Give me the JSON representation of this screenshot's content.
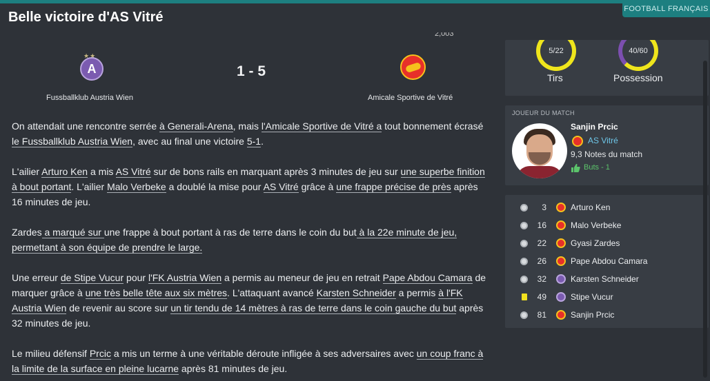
{
  "header": {
    "title": "Belle victoire d'AS Vitré",
    "tag": "FOOTBALL FRANÇAIS"
  },
  "match": {
    "home_team": "Fussballklub Austria Wien",
    "away_team": "Amicale Sportive de Vitré",
    "score": "1 - 5",
    "cut_number": "2,003"
  },
  "stats": {
    "shots": {
      "label": "Tirs",
      "value": "5/22"
    },
    "possession": {
      "label": "Possession",
      "value": "40/60"
    }
  },
  "man_of_match": {
    "heading": "JOUEUR DU MATCH",
    "name": "Sanjin Prcic",
    "club": "AS Vitré",
    "rating": "9,3 Notes du match",
    "goals": "Buts - 1"
  },
  "events": [
    {
      "type": "goal",
      "minute": "3",
      "club": "vitre",
      "player": "Arturo Ken"
    },
    {
      "type": "goal",
      "minute": "16",
      "club": "vitre",
      "player": "Malo Verbeke"
    },
    {
      "type": "goal",
      "minute": "22",
      "club": "vitre",
      "player": "Gyasi Zardes"
    },
    {
      "type": "goal",
      "minute": "26",
      "club": "vitre",
      "player": "Pape Abdou Camara"
    },
    {
      "type": "goal",
      "minute": "32",
      "club": "austria",
      "player": "Karsten Schneider"
    },
    {
      "type": "yellow-card",
      "minute": "49",
      "club": "austria",
      "player": "Stipe Vucur"
    },
    {
      "type": "goal",
      "minute": "81",
      "club": "vitre",
      "player": "Sanjin Prcic"
    }
  ],
  "article": {
    "p1": [
      "On attendait une rencontre serrée ",
      "à Generali-Arena",
      ", mais ",
      "l'Amicale Sportive de Vitré a",
      " tout bonnement écrasé ",
      "le Fussballklub Austria Wien",
      ", avec au final une victoire ",
      "5-1",
      "."
    ],
    "p2": [
      "L'ailier ",
      "Arturo Ken",
      " a mis ",
      "AS Vitré",
      " sur de bons rails en marquant après 3 minutes de jeu sur ",
      "une superbe finition à bout portant",
      ". L'ailier ",
      "Malo Verbeke",
      " a doublé la mise pour ",
      "AS Vitré",
      " grâce à ",
      "une frappe précise de près",
      " après 16 minutes de jeu."
    ],
    "p3": [
      "Zardes",
      " a marqué sur ",
      "une frappe à bout portant à ras de terre dans le coin du but",
      " à la 22e minute de jeu, permettant à son équipe de prendre le large."
    ],
    "p4": [
      "Une erreur ",
      "de Stipe Vucur",
      " pour ",
      "l'FK Austria Wien",
      " a permis au meneur de jeu en retrait ",
      "Pape Abdou Camara",
      " de marquer grâce à ",
      "une très belle tête aux six mètres",
      ". L'attaquant avancé ",
      "Karsten Schneider",
      " a permis ",
      "à l'FK Austria Wien",
      " de revenir au score sur ",
      "un tir tendu de 14 mètres à ras de terre dans le coin gauche du but",
      " après 32 minutes de jeu."
    ],
    "p5": [
      "Le milieu défensif ",
      "Prcic",
      " a mis un terme à une véritable déroute infligée à ses adversaires avec ",
      "un coup franc à la limite de la surface en pleine lucarne",
      " après 81 minutes de jeu."
    ]
  },
  "colors": {
    "accent": "#1d7f80",
    "background": "#2e3238",
    "panel": "#383d44",
    "ring_yellow": "#efe51c",
    "ring_purple": "#7c4fb0",
    "link_blue": "#6ec6e8",
    "goal_green": "#5cc46b"
  }
}
